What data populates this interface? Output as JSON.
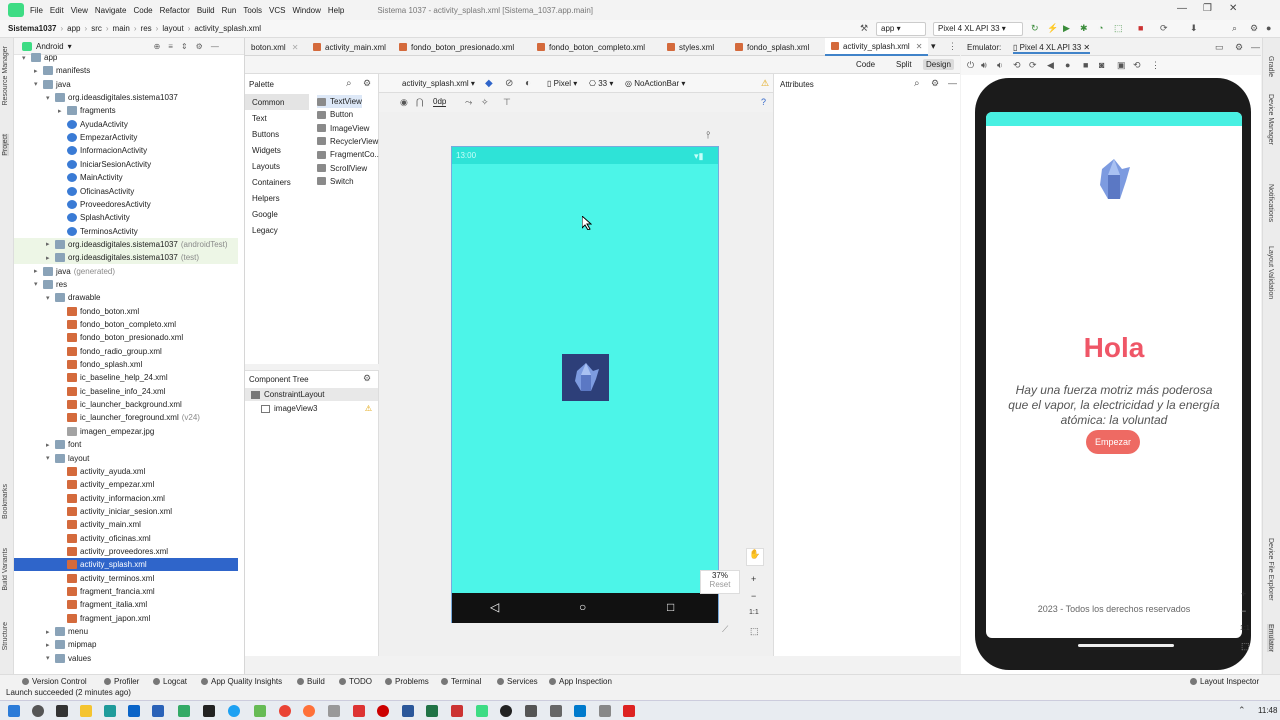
{
  "menubar": {
    "items": [
      "File",
      "Edit",
      "View",
      "Navigate",
      "Code",
      "Refactor",
      "Build",
      "Run",
      "Tools",
      "VCS",
      "Window",
      "Help"
    ],
    "window_title": "Sistema 1037 - activity_splash.xml [Sistema_1037.app.main]"
  },
  "navbar": {
    "crumbs": [
      "Sistema1037",
      "app",
      "src",
      "main",
      "res",
      "layout",
      "activity_splash.xml"
    ],
    "run_config": "app",
    "device": "Pixel 4 XL API 33"
  },
  "project": {
    "view_mode": "Android",
    "rows": [
      {
        "label": "app",
        "depth": 0,
        "arrow": "▾",
        "icon": "folder"
      },
      {
        "label": "manifests",
        "depth": 1,
        "arrow": "▸",
        "icon": "folder"
      },
      {
        "label": "java",
        "depth": 1,
        "arrow": "▾",
        "icon": "folder"
      },
      {
        "label": "org.ideasdigitales.sistema1037",
        "depth": 2,
        "arrow": "▾",
        "icon": "folder"
      },
      {
        "label": "fragments",
        "depth": 3,
        "arrow": "▸",
        "icon": "folder"
      },
      {
        "label": "AyudaActivity",
        "depth": 3,
        "arrow": "",
        "icon": "class"
      },
      {
        "label": "EmpezarActivity",
        "depth": 3,
        "arrow": "",
        "icon": "class"
      },
      {
        "label": "InformacionActivity",
        "depth": 3,
        "arrow": "",
        "icon": "class"
      },
      {
        "label": "IniciarSesionActivity",
        "depth": 3,
        "arrow": "",
        "icon": "class"
      },
      {
        "label": "MainActivity",
        "depth": 3,
        "arrow": "",
        "icon": "class"
      },
      {
        "label": "OficinasActivity",
        "depth": 3,
        "arrow": "",
        "icon": "class"
      },
      {
        "label": "ProveedoresActivity",
        "depth": 3,
        "arrow": "",
        "icon": "class"
      },
      {
        "label": "SplashActivity",
        "depth": 3,
        "arrow": "",
        "icon": "class"
      },
      {
        "label": "TerminosActivity",
        "depth": 3,
        "arrow": "",
        "icon": "class"
      },
      {
        "label": "org.ideasdigitales.sistema1037",
        "depth": 2,
        "arrow": "▸",
        "icon": "folder",
        "sub": "(androidTest)",
        "test": true
      },
      {
        "label": "org.ideasdigitales.sistema1037",
        "depth": 2,
        "arrow": "▸",
        "icon": "folder",
        "sub": "(test)",
        "test": true
      },
      {
        "label": "java",
        "depth": 1,
        "arrow": "▸",
        "icon": "folder",
        "sub": "(generated)"
      },
      {
        "label": "res",
        "depth": 1,
        "arrow": "▾",
        "icon": "folder"
      },
      {
        "label": "drawable",
        "depth": 2,
        "arrow": "▾",
        "icon": "folder"
      },
      {
        "label": "fondo_boton.xml",
        "depth": 3,
        "arrow": "",
        "icon": "xml"
      },
      {
        "label": "fondo_boton_completo.xml",
        "depth": 3,
        "arrow": "",
        "icon": "xml"
      },
      {
        "label": "fondo_boton_presionado.xml",
        "depth": 3,
        "arrow": "",
        "icon": "xml"
      },
      {
        "label": "fondo_radio_group.xml",
        "depth": 3,
        "arrow": "",
        "icon": "xml"
      },
      {
        "label": "fondo_splash.xml",
        "depth": 3,
        "arrow": "",
        "icon": "xml"
      },
      {
        "label": "ic_baseline_help_24.xml",
        "depth": 3,
        "arrow": "",
        "icon": "xml"
      },
      {
        "label": "ic_baseline_info_24.xml",
        "depth": 3,
        "arrow": "",
        "icon": "xml"
      },
      {
        "label": "ic_launcher_background.xml",
        "depth": 3,
        "arrow": "",
        "icon": "xml"
      },
      {
        "label": "ic_launcher_foreground.xml",
        "depth": 3,
        "arrow": "",
        "icon": "xml",
        "sub": "(v24)"
      },
      {
        "label": "imagen_empezar.jpg",
        "depth": 3,
        "arrow": "",
        "icon": "img"
      },
      {
        "label": "font",
        "depth": 2,
        "arrow": "▸",
        "icon": "folder"
      },
      {
        "label": "layout",
        "depth": 2,
        "arrow": "▾",
        "icon": "folder"
      },
      {
        "label": "activity_ayuda.xml",
        "depth": 3,
        "arrow": "",
        "icon": "xml"
      },
      {
        "label": "activity_empezar.xml",
        "depth": 3,
        "arrow": "",
        "icon": "xml"
      },
      {
        "label": "activity_informacion.xml",
        "depth": 3,
        "arrow": "",
        "icon": "xml"
      },
      {
        "label": "activity_iniciar_sesion.xml",
        "depth": 3,
        "arrow": "",
        "icon": "xml"
      },
      {
        "label": "activity_main.xml",
        "depth": 3,
        "arrow": "",
        "icon": "xml"
      },
      {
        "label": "activity_oficinas.xml",
        "depth": 3,
        "arrow": "",
        "icon": "xml"
      },
      {
        "label": "activity_proveedores.xml",
        "depth": 3,
        "arrow": "",
        "icon": "xml"
      },
      {
        "label": "activity_splash.xml",
        "depth": 3,
        "arrow": "",
        "icon": "xml",
        "selected": true
      },
      {
        "label": "activity_terminos.xml",
        "depth": 3,
        "arrow": "",
        "icon": "xml"
      },
      {
        "label": "fragment_francia.xml",
        "depth": 3,
        "arrow": "",
        "icon": "xml"
      },
      {
        "label": "fragment_italia.xml",
        "depth": 3,
        "arrow": "",
        "icon": "xml"
      },
      {
        "label": "fragment_japon.xml",
        "depth": 3,
        "arrow": "",
        "icon": "xml"
      },
      {
        "label": "menu",
        "depth": 2,
        "arrow": "▸",
        "icon": "folder"
      },
      {
        "label": "mipmap",
        "depth": 2,
        "arrow": "▸",
        "icon": "folder"
      },
      {
        "label": "values",
        "depth": 2,
        "arrow": "▾",
        "icon": "folder"
      }
    ]
  },
  "left_strip": [
    "Resource Manager",
    "Project",
    "Bookmarks",
    "Build Variants",
    "Structure"
  ],
  "editor_tabs": [
    "boton.xml",
    "activity_main.xml",
    "fondo_boton_presionado.xml",
    "fondo_boton_completo.xml",
    "styles.xml",
    "fondo_splash.xml",
    "activity_splash.xml"
  ],
  "view_modes": [
    "Code",
    "Split",
    "Design"
  ],
  "palette": {
    "title": "Palette",
    "categories": [
      "Common",
      "Text",
      "Buttons",
      "Widgets",
      "Layouts",
      "Containers",
      "Helpers",
      "Google",
      "Legacy"
    ],
    "items": [
      "TextView",
      "Button",
      "ImageView",
      "RecyclerView",
      "FragmentCo...",
      "ScrollView",
      "Switch"
    ]
  },
  "component_tree": {
    "title": "Component Tree",
    "root": "ConstraintLayout",
    "child": "imageView3"
  },
  "canvas_bar": {
    "file": "activity_splash.xml",
    "device": "Pixel",
    "api": "33",
    "theme": "NoActionBar",
    "margin": "0dp"
  },
  "canvas": {
    "status_time": "13:00",
    "zoom": "37%",
    "reset": "Reset",
    "ratio": "1:1"
  },
  "attributes": {
    "title": "Attributes"
  },
  "emulator": {
    "label": "Emulator:",
    "device_tab": "Pixel 4 XL API 33",
    "heading": "Hola",
    "quote": "Hay una fuerza motriz más poderosa que el vapor, la electricidad y la energía atómica: la voluntad",
    "button": "Empezar",
    "footer": "2023 - Todos los derechos reservados",
    "ratio": "1:1"
  },
  "right_strip": [
    "Gradle",
    "Device Manager",
    "Notifications",
    "Layout Validation",
    "Device File Explorer",
    "Emulator"
  ],
  "bottom_tabs": [
    "Version Control",
    "Profiler",
    "Logcat",
    "App Quality Insights",
    "Build",
    "TODO",
    "Problems",
    "Terminal",
    "Services",
    "App Inspection"
  ],
  "layout_inspector": "Layout Inspector",
  "status_message": "Launch succeeded (2 minutes ago)",
  "clock": "11:48",
  "colors": {
    "accent": "#2f65ca",
    "splash_bg": "#4cf5e8",
    "hola": "#ef5667",
    "button": "#ee6a63"
  }
}
